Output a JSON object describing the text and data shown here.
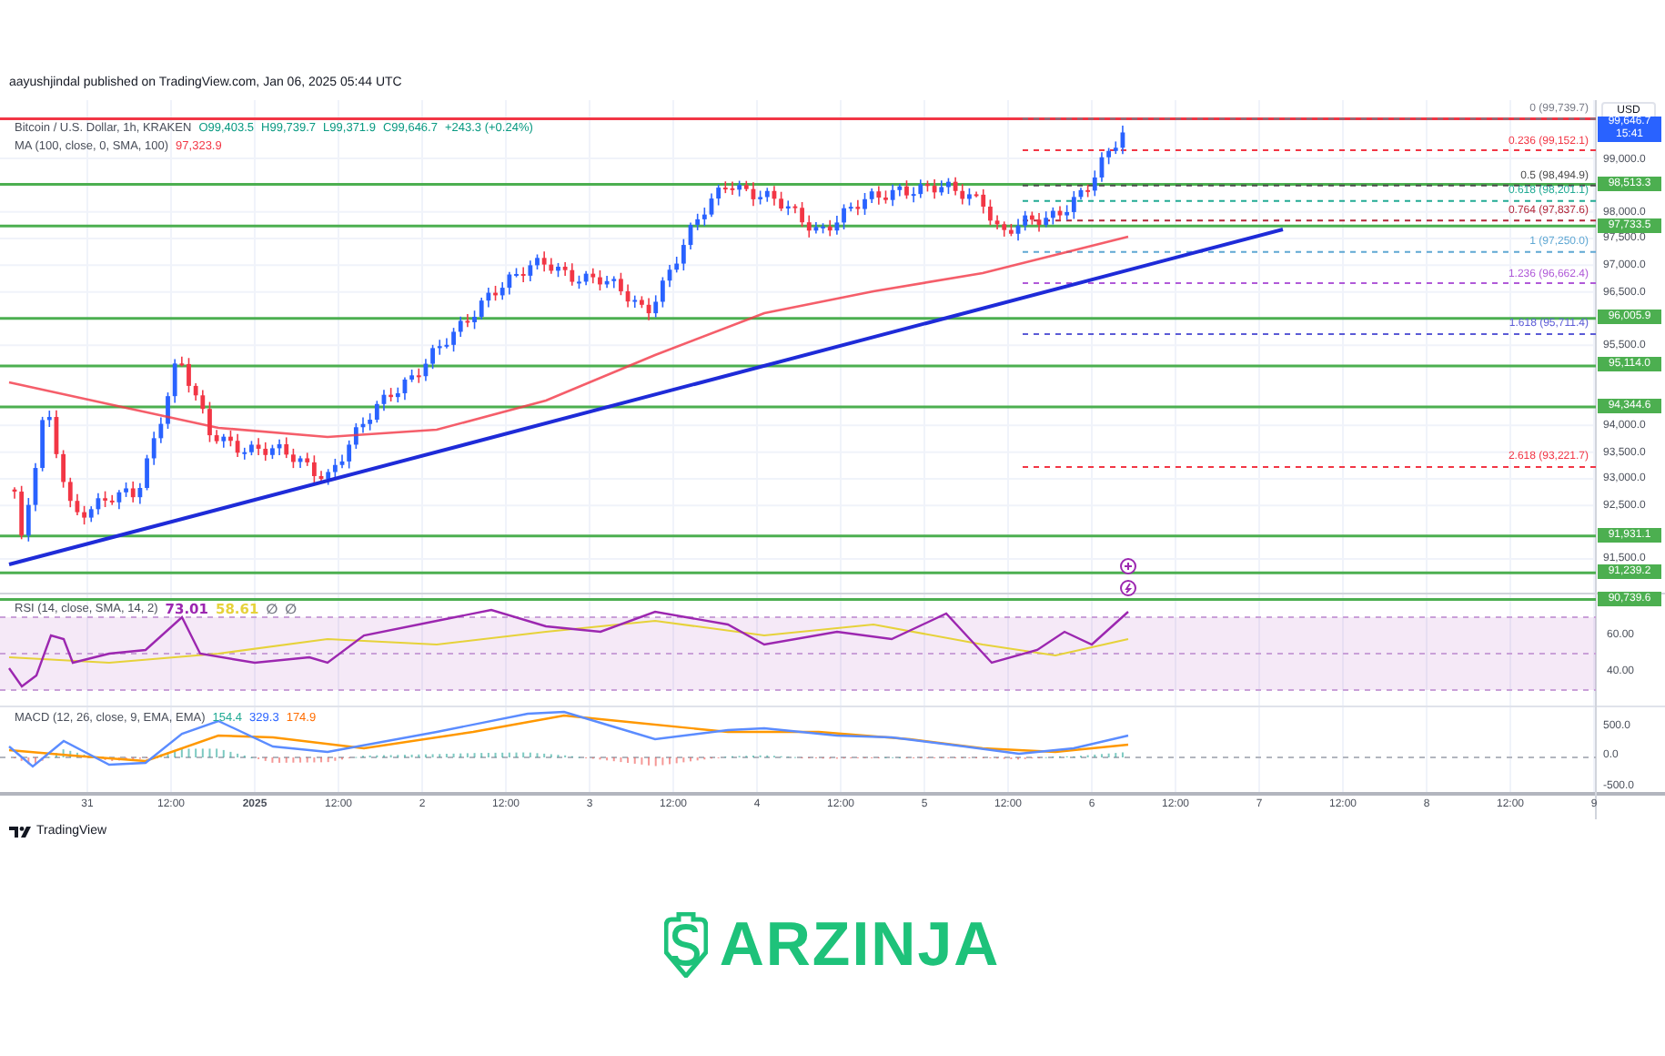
{
  "attribution": "aayushjindal published on TradingView.com, Jan 06, 2025 05:44 UTC",
  "legend": {
    "symbol": "Bitcoin / U.S. Dollar, 1h, KRAKEN",
    "open": "O99,403.5",
    "high": "H99,739.7",
    "low": "L99,371.9",
    "close": "C99,646.7",
    "change": "+243.3 (+0.24%)"
  },
  "ma_legend": {
    "label": "MA (100, close, 0, SMA, 100)",
    "value": "97,323.9"
  },
  "currency": "USD",
  "last_price": {
    "price": "99,646.7",
    "countdown": "15:41"
  },
  "price_axis": [
    "99,000.0",
    "98,000.0",
    "97,500.0",
    "97,000.0",
    "96,500.0",
    "95,500.0",
    "94,000.0",
    "93,500.0",
    "93,000.0",
    "92,500.0",
    "91,500.0"
  ],
  "levels": [
    "98,513.3",
    "97,733.5",
    "96,005.9",
    "95,114.0",
    "94,344.6",
    "91,931.1",
    "91,239.2",
    "90,739.6"
  ],
  "fib_levels": [
    {
      "label": "0 (99,739.7)",
      "color": "#787b86"
    },
    {
      "label": "0.236 (99,152.1)",
      "color": "#f23645"
    },
    {
      "label": "0.5 (98,494.9)",
      "color": "#4a4a4a"
    },
    {
      "label": "0.618 (98,201.1)",
      "color": "#22ab94"
    },
    {
      "label": "0.764 (97,837.6)",
      "color": "#b2283a"
    },
    {
      "label": "1 (97,250.0)",
      "color": "#5fa8d3"
    },
    {
      "label": "1.236 (96,662.4)",
      "color": "#b05ad8"
    },
    {
      "label": "1.618 (95,711.4)",
      "color": "#5b5bd6"
    },
    {
      "label": "2.618 (93,221.7)",
      "color": "#f23645"
    }
  ],
  "rsi": {
    "label": "RSI (14, close, SMA, 14, 2)",
    "values": [
      {
        "text": "73.01",
        "color": "#9c27b0"
      },
      {
        "text": "58.61",
        "color": "#e6d23a"
      },
      {
        "text": "∅",
        "color": "#787b86"
      },
      {
        "text": "∅",
        "color": "#787b86"
      }
    ],
    "axis": [
      "60.00",
      "40.00"
    ]
  },
  "macd": {
    "label": "MACD (12, 26, close, 9, EMA, EMA)",
    "values": [
      {
        "text": "154.4",
        "color": "#22ab94"
      },
      {
        "text": "329.3",
        "color": "#2962ff"
      },
      {
        "text": "174.9",
        "color": "#ff6d00"
      }
    ],
    "axis": [
      "500.0",
      "0.0",
      "-500.0"
    ]
  },
  "time_axis": [
    "31",
    "12:00",
    "2025",
    "12:00",
    "2",
    "12:00",
    "3",
    "12:00",
    "4",
    "12:00",
    "5",
    "12:00",
    "6",
    "12:00",
    "7",
    "12:00",
    "8",
    "12:00",
    "9"
  ],
  "footer": "TradingView",
  "brand": "ARZINJA"
}
